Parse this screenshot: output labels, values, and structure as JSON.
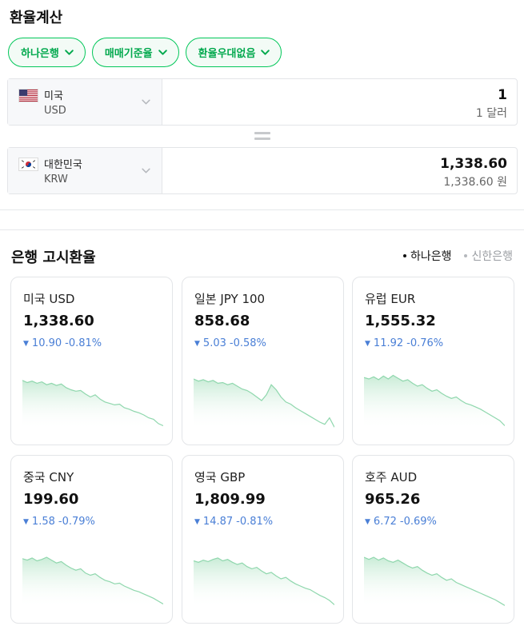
{
  "calculator": {
    "title": "환율계산",
    "filters": [
      "하나은행",
      "매매기준율",
      "환율우대없음"
    ],
    "from": {
      "name": "미국",
      "code": "USD",
      "amount": "1",
      "amount_text": "1 달러"
    },
    "to": {
      "name": "대한민국",
      "code": "KRW",
      "amount": "1,338.60",
      "amount_text": "1,338.60 원"
    }
  },
  "bank": {
    "title": "은행 고시환율",
    "tabs": [
      {
        "label": "하나은행",
        "active": true
      },
      {
        "label": "신한은행",
        "active": false
      }
    ]
  },
  "colors": {
    "accent": "#03c75a",
    "down": "#4a7fd6",
    "spark_line": "#8fd7ad"
  },
  "cards": [
    {
      "name": "미국 USD",
      "rate": "1,338.60",
      "change": "10.90",
      "percent": "-0.81%",
      "direction": "down",
      "trend": [
        0.32,
        0.35,
        0.33,
        0.36,
        0.34,
        0.38,
        0.36,
        0.39,
        0.37,
        0.42,
        0.45,
        0.47,
        0.46,
        0.51,
        0.55,
        0.52,
        0.58,
        0.62,
        0.64,
        0.66,
        0.65,
        0.7,
        0.72,
        0.75,
        0.77,
        0.8,
        0.84,
        0.86,
        0.92,
        0.95
      ]
    },
    {
      "name": "일본 JPY 100",
      "rate": "858.68",
      "change": "5.03",
      "percent": "-0.58%",
      "direction": "down",
      "trend": [
        0.3,
        0.33,
        0.31,
        0.34,
        0.32,
        0.36,
        0.35,
        0.38,
        0.36,
        0.4,
        0.44,
        0.46,
        0.5,
        0.55,
        0.6,
        0.52,
        0.38,
        0.45,
        0.55,
        0.62,
        0.65,
        0.7,
        0.74,
        0.78,
        0.82,
        0.86,
        0.9,
        0.93,
        0.84,
        0.97
      ]
    },
    {
      "name": "유럽 EUR",
      "rate": "1,555.32",
      "change": "11.92",
      "percent": "-0.76%",
      "direction": "down",
      "trend": [
        0.28,
        0.3,
        0.27,
        0.31,
        0.26,
        0.3,
        0.25,
        0.29,
        0.33,
        0.31,
        0.36,
        0.4,
        0.38,
        0.43,
        0.47,
        0.45,
        0.5,
        0.54,
        0.57,
        0.55,
        0.6,
        0.64,
        0.66,
        0.69,
        0.72,
        0.76,
        0.8,
        0.84,
        0.88,
        0.95
      ]
    },
    {
      "name": "중국 CNY",
      "rate": "199.60",
      "change": "1.58",
      "percent": "-0.79%",
      "direction": "down",
      "trend": [
        0.32,
        0.34,
        0.31,
        0.35,
        0.33,
        0.3,
        0.34,
        0.38,
        0.36,
        0.41,
        0.45,
        0.48,
        0.46,
        0.52,
        0.55,
        0.53,
        0.58,
        0.62,
        0.64,
        0.67,
        0.66,
        0.7,
        0.73,
        0.76,
        0.78,
        0.81,
        0.84,
        0.87,
        0.91,
        0.95
      ]
    },
    {
      "name": "영국 GBP",
      "rate": "1,809.99",
      "change": "14.87",
      "percent": "-0.81%",
      "direction": "down",
      "trend": [
        0.35,
        0.37,
        0.34,
        0.36,
        0.33,
        0.31,
        0.35,
        0.33,
        0.37,
        0.4,
        0.38,
        0.43,
        0.46,
        0.44,
        0.49,
        0.53,
        0.51,
        0.56,
        0.6,
        0.58,
        0.63,
        0.67,
        0.7,
        0.73,
        0.75,
        0.79,
        0.83,
        0.86,
        0.9,
        0.96
      ]
    },
    {
      "name": "호주 AUD",
      "rate": "965.26",
      "change": "6.72",
      "percent": "-0.69%",
      "direction": "down",
      "trend": [
        0.3,
        0.33,
        0.3,
        0.34,
        0.31,
        0.35,
        0.37,
        0.34,
        0.38,
        0.42,
        0.45,
        0.43,
        0.48,
        0.52,
        0.55,
        0.53,
        0.58,
        0.62,
        0.6,
        0.65,
        0.68,
        0.71,
        0.74,
        0.77,
        0.8,
        0.83,
        0.86,
        0.89,
        0.93,
        0.97
      ]
    }
  ]
}
